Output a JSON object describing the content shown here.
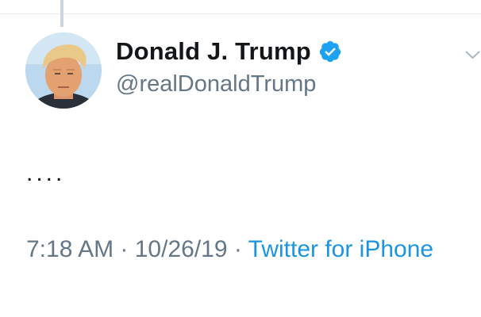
{
  "tweet": {
    "author": {
      "display_name": "Donald J. Trump",
      "handle": "@realDonaldTrump",
      "verified": true,
      "avatar_icon": "profile-photo"
    },
    "text": "....",
    "timestamp": "7:18 AM",
    "separator": " · ",
    "date": "10/26/19",
    "source": "Twitter for iPhone",
    "menu_icon": "chevron-down-icon"
  },
  "colors": {
    "text_primary": "#14171a",
    "text_secondary": "#657786",
    "link": "#1b95e0",
    "verified_badge": "#1da1f2",
    "divider": "#e6ecf0",
    "thread_line": "#ccd6dd"
  }
}
